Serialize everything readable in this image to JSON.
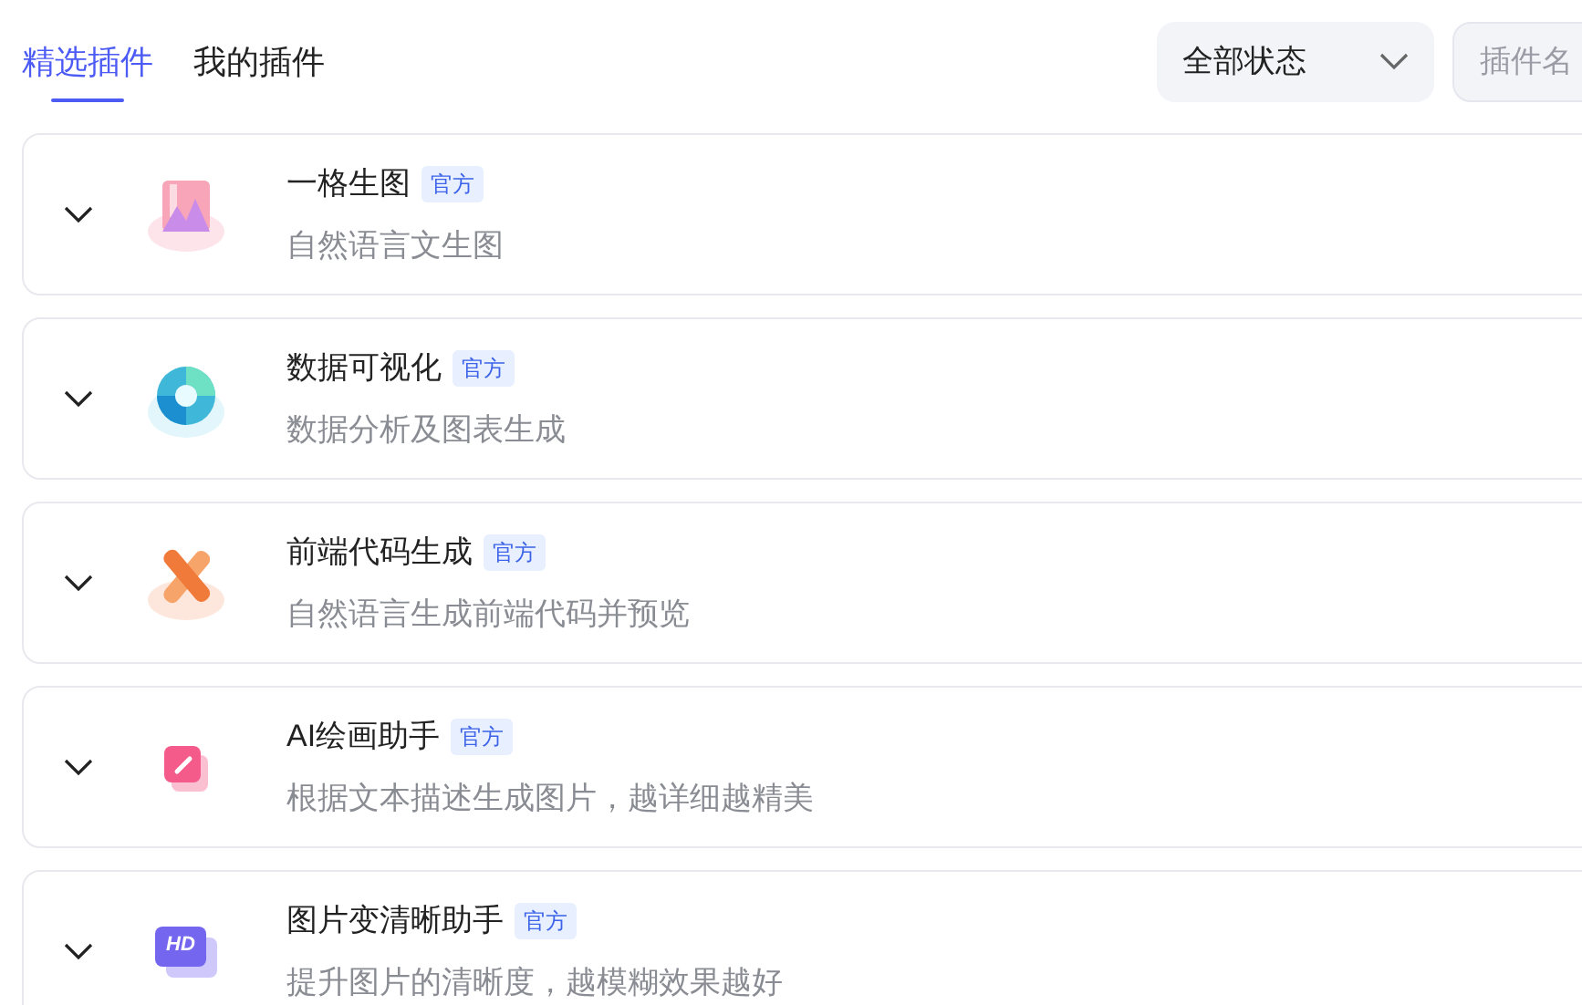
{
  "tabs": [
    {
      "label": "精选插件",
      "selected": true
    },
    {
      "label": "我的插件",
      "selected": false
    }
  ],
  "status_filter": {
    "value": "全部状态"
  },
  "search": {
    "placeholder": "插件名"
  },
  "plugins": [
    {
      "title": "一格生图",
      "badge": "官方",
      "description": "自然语言文生图",
      "kind": "image",
      "expanded": false
    },
    {
      "title": "数据可视化",
      "badge": "官方",
      "description": "数据分析及图表生成",
      "kind": "chart",
      "expanded": false
    },
    {
      "title": "前端代码生成",
      "badge": "官方",
      "description": "自然语言生成前端代码并预览",
      "kind": "code",
      "expanded": false
    },
    {
      "title": "AI绘画助手",
      "badge": "官方",
      "description": "根据文本描述生成图片，越详细越精美",
      "kind": "paint",
      "expanded": false
    },
    {
      "title": "图片变清晰助手",
      "badge": "官方",
      "description": "提升图片的清晰度，越模糊效果越好",
      "kind": "hd",
      "icon_label": "HD",
      "expanded": false
    }
  ]
}
